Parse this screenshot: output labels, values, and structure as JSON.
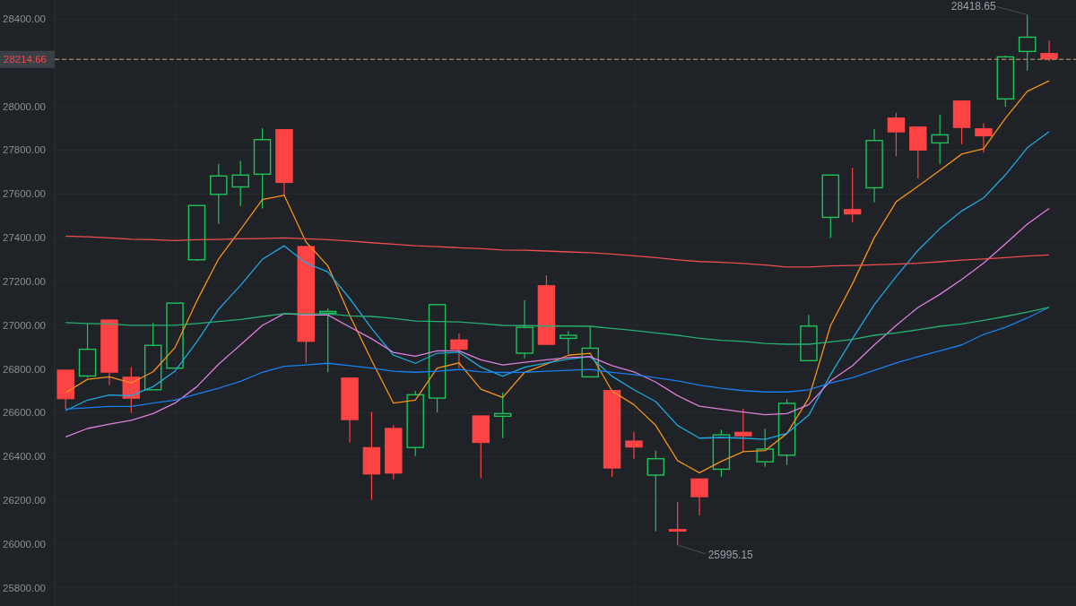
{
  "chart": {
    "chart_data": {
      "type": "line",
      "ylim": [
        25717,
        28486
      ],
      "grid": true,
      "yticks": [
        {
          "value": 28400,
          "label": "28400.00"
        },
        {
          "value": 28000,
          "label": "28000.00"
        },
        {
          "value": 27800,
          "label": "27800.00"
        },
        {
          "value": 27600,
          "label": "27600.00"
        },
        {
          "value": 27400,
          "label": "27400.00"
        },
        {
          "value": 27200,
          "label": "27200.00"
        },
        {
          "value": 27000,
          "label": "27000.00"
        },
        {
          "value": 26800,
          "label": "26800.00"
        },
        {
          "value": 26600,
          "label": "26600.00"
        },
        {
          "value": 26400,
          "label": "26400.00"
        },
        {
          "value": 26200,
          "label": "26200.00"
        },
        {
          "value": 26000,
          "label": "26000.00"
        },
        {
          "value": 25800,
          "label": "25800.00"
        }
      ],
      "series": [
        {
          "type": "candlestick",
          "ohlc": [
            [
              26797,
              26797,
              26617,
              26662
            ],
            [
              26768,
              27007,
              26760,
              26890
            ],
            [
              27026,
              27026,
              26726,
              26783
            ],
            [
              26765,
              26810,
              26600,
              26664
            ],
            [
              26705,
              27010,
              26705,
              26908
            ],
            [
              26804,
              27101,
              26804,
              27101
            ],
            [
              27299,
              27547,
              27294,
              27547
            ],
            [
              27598,
              27736,
              27463,
              27682
            ],
            [
              27632,
              27751,
              27545,
              27686
            ],
            [
              27690,
              27900,
              27533,
              27848
            ],
            [
              27896,
              27896,
              27592,
              27650
            ],
            [
              27362,
              27362,
              26828,
              26924
            ],
            [
              27055,
              27078,
              26785,
              27063
            ],
            [
              26761,
              26761,
              26464,
              26566
            ],
            [
              26443,
              26605,
              26202,
              26318
            ],
            [
              26531,
              26544,
              26296,
              26322
            ],
            [
              26441,
              26700,
              26402,
              26682
            ],
            [
              26667,
              27094,
              26602,
              27094
            ],
            [
              26935,
              26962,
              26804,
              26888
            ],
            [
              26588,
              26588,
              26301,
              26462
            ],
            [
              26584,
              26692,
              26484,
              26596
            ],
            [
              26872,
              27114,
              26849,
              26990
            ],
            [
              27183,
              27228,
              26910,
              26910
            ],
            [
              26940,
              26974,
              26869,
              26954
            ],
            [
              26764,
              26992,
              26764,
              26895
            ],
            [
              26704,
              26704,
              26306,
              26345
            ],
            [
              26473,
              26513,
              26390,
              26441
            ],
            [
              26315,
              26427,
              26058,
              26390
            ],
            [
              26069,
              26192,
              25995.15,
              26057
            ],
            [
              26300,
              26300,
              26132,
              26214
            ],
            [
              26342,
              26523,
              26306,
              26499
            ],
            [
              26513,
              26618,
              26423,
              26492
            ],
            [
              26376,
              26527,
              26353,
              26434
            ],
            [
              26406,
              26662,
              26361,
              26643
            ],
            [
              26838,
              27047,
              26838,
              26996
            ],
            [
              27493,
              27686,
              27400,
              27686
            ],
            [
              27531,
              27719,
              27471,
              27506
            ],
            [
              27628,
              27896,
              27561,
              27844
            ],
            [
              27949,
              27971,
              27772,
              27881
            ],
            [
              27908,
              27908,
              27671,
              27798
            ],
            [
              27833,
              27961,
              27736,
              27870
            ],
            [
              28027,
              28027,
              27827,
              27901
            ],
            [
              27900,
              27923,
              27789,
              27863
            ],
            [
              28034,
              28232,
              27998,
              28226
            ],
            [
              28251,
              28418.65,
              28163,
              28316
            ],
            [
              28244,
              28301,
              28206,
              28214.66
            ]
          ]
        },
        {
          "color": "#f7931a",
          "values": [
            26692,
            26753,
            26764,
            26736,
            26787,
            26897,
            27110,
            27303,
            27437,
            27574,
            27594,
            27380,
            27271,
            27044,
            26839,
            26644,
            26658,
            26804,
            26828,
            26708,
            26670,
            26785,
            26822,
            26863,
            26872,
            26699,
            26637,
            26542,
            26381,
            26326,
            26378,
            26422,
            26427,
            26505,
            26667,
            26999,
            27189,
            27400,
            27564,
            27635,
            27708,
            27782,
            27807,
            27946,
            28069,
            28117
          ]
        },
        {
          "color": "#1fa9e1",
          "values": [
            26610,
            26658,
            26681,
            26678,
            26719,
            26790,
            26924,
            27073,
            27182,
            27301,
            27363,
            27284,
            27243,
            27122,
            26985,
            26863,
            26826,
            26872,
            26876,
            26808,
            26767,
            26808,
            26828,
            26845,
            26856,
            26767,
            26705,
            26651,
            26542,
            26484,
            26487,
            26484,
            26478,
            26506,
            26589,
            26774,
            26938,
            27094,
            27223,
            27342,
            27441,
            27522,
            27582,
            27687,
            27811,
            27885
          ]
        },
        {
          "color": "#e07ee0",
          "values": [
            26490,
            26528,
            26548,
            26565,
            26596,
            26644,
            26719,
            26822,
            26910,
            26999,
            27053,
            27047,
            27047,
            26992,
            26938,
            26876,
            26858,
            26883,
            26883,
            26842,
            26818,
            26831,
            26842,
            26852,
            26856,
            26815,
            26787,
            26740,
            26678,
            26630,
            26617,
            26603,
            26591,
            26596,
            26637,
            26746,
            26815,
            26910,
            26999,
            27081,
            27141,
            27209,
            27284,
            27372,
            27462,
            27534
          ]
        },
        {
          "color": "#1a7ff0",
          "values": [
            26617,
            26623,
            26629,
            26629,
            26644,
            26658,
            26685,
            26712,
            26744,
            26785,
            26812,
            26818,
            26826,
            26815,
            26804,
            26790,
            26785,
            26790,
            26798,
            26787,
            26784,
            26785,
            26790,
            26794,
            26798,
            26785,
            26774,
            26760,
            26746,
            26726,
            26712,
            26701,
            26695,
            26695,
            26705,
            26736,
            26760,
            26794,
            26828,
            26856,
            26883,
            26910,
            26958,
            26990,
            27033,
            27082
          ]
        },
        {
          "color": "#27ae72",
          "values": [
            27012,
            27008,
            27006,
            27000,
            27000,
            27000,
            27008,
            27017,
            27026,
            27040,
            27053,
            27052,
            27052,
            27043,
            27040,
            27031,
            27019,
            27017,
            27015,
            27008,
            26999,
            26998,
            26996,
            26996,
            26995,
            26985,
            26976,
            26965,
            26954,
            26940,
            26931,
            26926,
            26917,
            26913,
            26913,
            26924,
            26935,
            26954,
            26965,
            26979,
            26995,
            27006,
            27022,
            27040,
            27060,
            27082
          ]
        },
        {
          "color": "#ec4f4f",
          "values": [
            27407,
            27404,
            27399,
            27393,
            27391,
            27387,
            27391,
            27392,
            27395,
            27396,
            27399,
            27395,
            27391,
            27385,
            27377,
            27370,
            27363,
            27359,
            27354,
            27350,
            27344,
            27343,
            27339,
            27335,
            27331,
            27325,
            27317,
            27309,
            27299,
            27291,
            27287,
            27282,
            27275,
            27266,
            27266,
            27271,
            27273,
            27276,
            27279,
            27283,
            27290,
            27298,
            27303,
            27309,
            27316,
            27321
          ]
        }
      ],
      "ref_lines": [
        {
          "axis": "y",
          "value": 28214.66,
          "label": "28214.66"
        }
      ],
      "annotations": [
        "28418.65",
        "25995.15"
      ]
    }
  }
}
